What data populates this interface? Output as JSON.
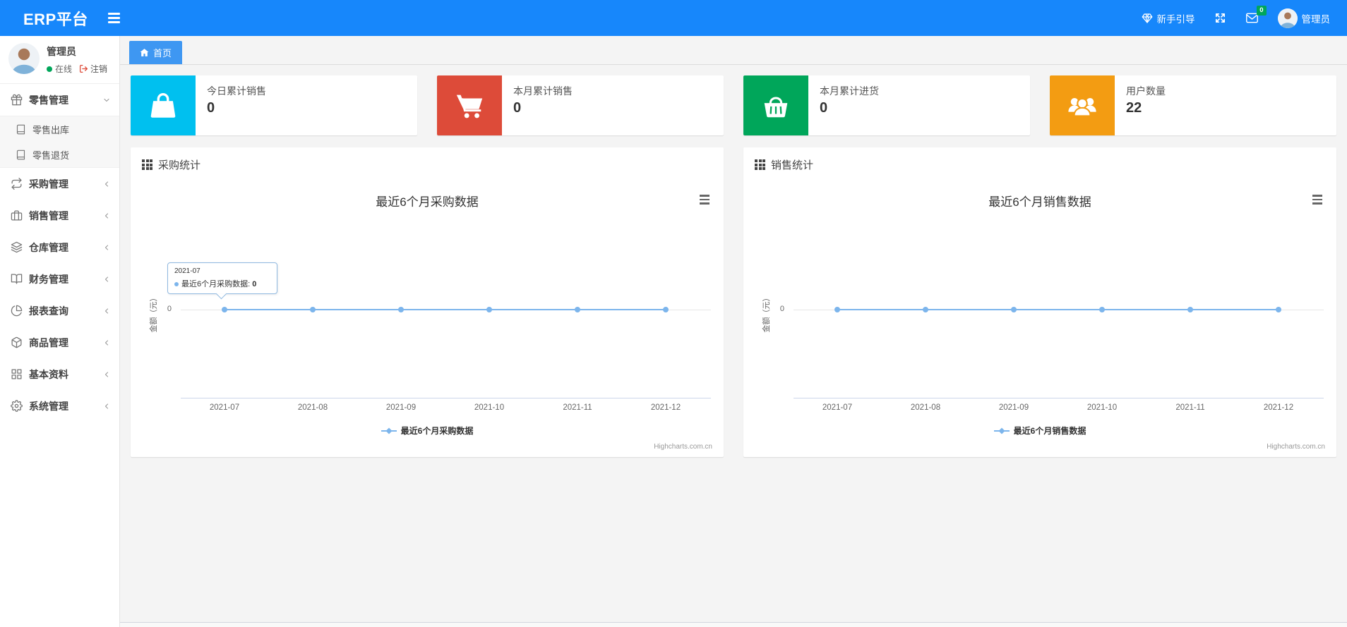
{
  "navbar": {
    "brand": "ERP平台",
    "guide_label": "新手引导",
    "message_count": "0",
    "username": "管理员"
  },
  "sidebar": {
    "user": {
      "name": "管理员",
      "status_label": "在线",
      "logout_label": "注销"
    },
    "items": [
      {
        "label": "零售管理",
        "icon": "gift-icon",
        "expanded": true,
        "children": [
          {
            "label": "零售出库",
            "icon": "book-icon"
          },
          {
            "label": "零售退货",
            "icon": "book-icon"
          }
        ]
      },
      {
        "label": "采购管理",
        "icon": "repeat-icon"
      },
      {
        "label": "销售管理",
        "icon": "briefcase-icon"
      },
      {
        "label": "仓库管理",
        "icon": "layers-icon"
      },
      {
        "label": "财务管理",
        "icon": "ledger-icon"
      },
      {
        "label": "报表查询",
        "icon": "pie-chart-icon"
      },
      {
        "label": "商品管理",
        "icon": "package-icon"
      },
      {
        "label": "基本资料",
        "icon": "grid-icon"
      },
      {
        "label": "系统管理",
        "icon": "gear-icon"
      }
    ]
  },
  "tabbar": {
    "tabs": [
      {
        "label": "首页",
        "active": true
      }
    ]
  },
  "cards": [
    {
      "label": "今日累计销售",
      "value": "0",
      "color": "#00c0ef",
      "icon": "shopping-bag-icon"
    },
    {
      "label": "本月累计销售",
      "value": "0",
      "color": "#dd4b39",
      "icon": "shopping-cart-icon"
    },
    {
      "label": "本月累计进货",
      "value": "0",
      "color": "#00a65a",
      "icon": "shopping-basket-icon"
    },
    {
      "label": "用户数量",
      "value": "22",
      "color": "#f39c12",
      "icon": "users-icon"
    }
  ],
  "panels": [
    {
      "header": "采购统计"
    },
    {
      "header": "销售统计"
    }
  ],
  "chart_data": [
    {
      "type": "line",
      "title": "最近6个月采购数据",
      "categories": [
        "2021-07",
        "2021-08",
        "2021-09",
        "2021-10",
        "2021-11",
        "2021-12"
      ],
      "series": [
        {
          "name": "最近6个月采购数据",
          "values": [
            0,
            0,
            0,
            0,
            0,
            0
          ]
        }
      ],
      "xlabel": "",
      "ylabel": "金额（元）",
      "yticks": [
        "0"
      ],
      "grid": true,
      "legend_position": "bottom",
      "line_color": "#7cb5ec",
      "credits": "Highcharts.com.cn",
      "tooltip": {
        "header": "2021-07",
        "series_label": "最近6个月采购数据: ",
        "value": "0"
      }
    },
    {
      "type": "line",
      "title": "最近6个月销售数据",
      "categories": [
        "2021-07",
        "2021-08",
        "2021-09",
        "2021-10",
        "2021-11",
        "2021-12"
      ],
      "series": [
        {
          "name": "最近6个月销售数据",
          "values": [
            0,
            0,
            0,
            0,
            0,
            0
          ]
        }
      ],
      "xlabel": "",
      "ylabel": "金额（元）",
      "yticks": [
        "0"
      ],
      "grid": true,
      "legend_position": "bottom",
      "line_color": "#7cb5ec",
      "credits": "Highcharts.com.cn"
    }
  ]
}
